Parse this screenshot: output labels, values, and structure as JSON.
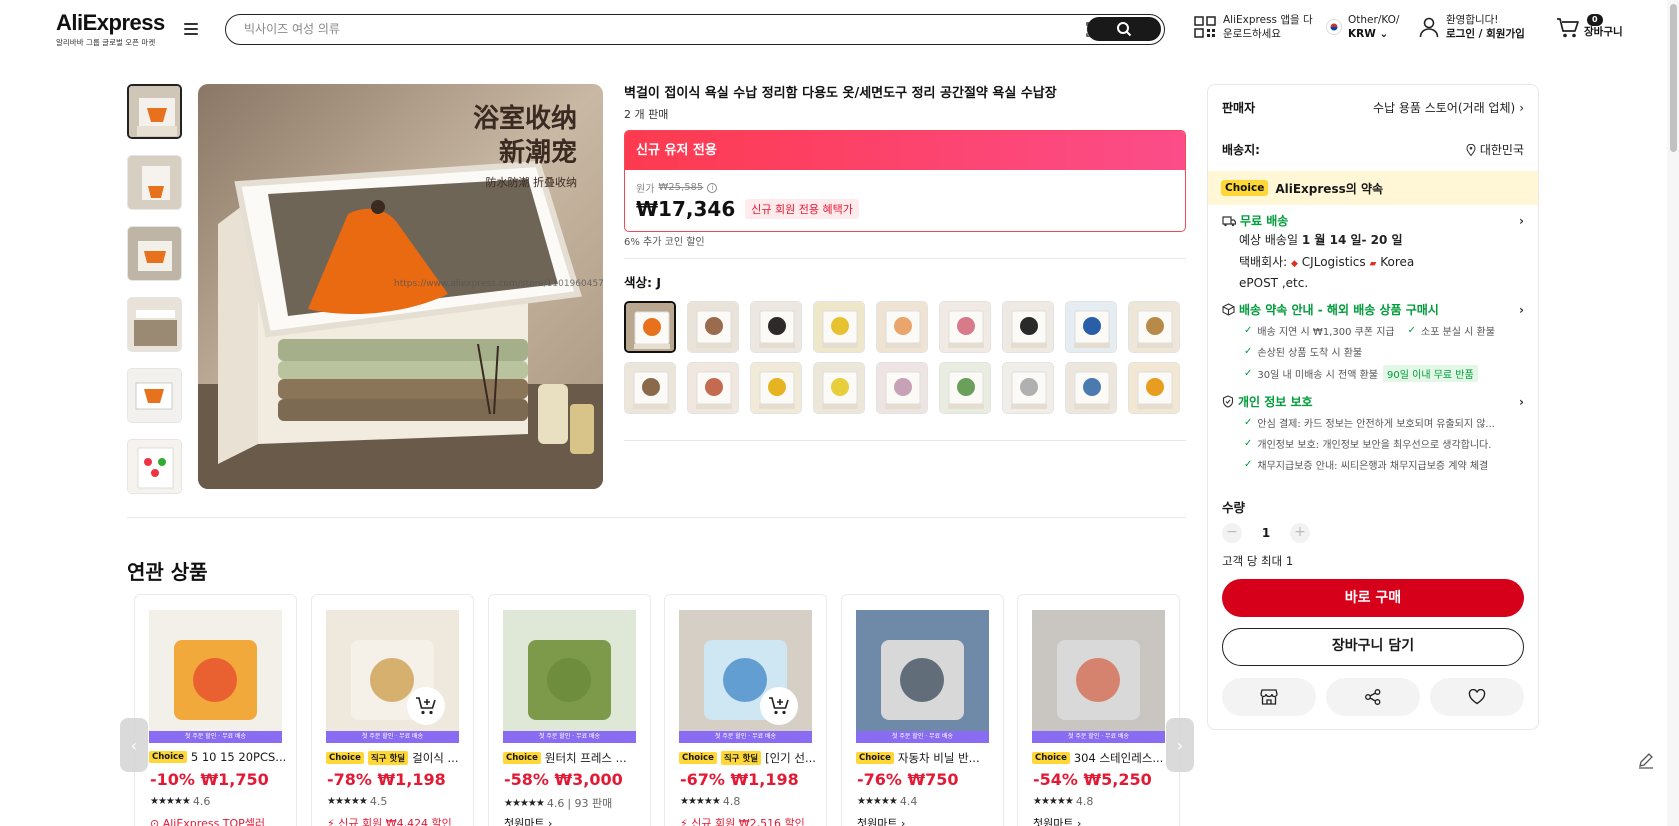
{
  "header": {
    "logo": "AliExpress",
    "logo_sub": "알리바바 그룹 글로벌 오픈 마켓",
    "search_placeholder": "빅사이즈 여성 의류",
    "app_line1": "AliExpress 앱을 다",
    "app_line2": "운로드하세요",
    "lang_line1": "Other/KO/",
    "lang_line2": "KRW",
    "account_line1": "환영합니다!",
    "account_line2": "로그인 / 회원가입",
    "cart_count": "0",
    "cart_label": "장바구니"
  },
  "gallery": {
    "cn_line1": "浴室收纳",
    "cn_line2": "新潮宠",
    "cn_line3": "防水防潮 折叠收纳",
    "watermark": "https://www.aliexpress.com/store/1101960457"
  },
  "product": {
    "title": "벽걸이 접이식 욕실 수납 정리함 다용도 옷/세면도구 정리 공간절약 욕실 수납장",
    "sold": "2 개 판매",
    "promo_head": "신규 유저 전용",
    "orig_label": "원가",
    "orig_price": "₩25,585",
    "price": "₩17,346",
    "new_tag": "신규 회원 전용 혜택가",
    "coin": "6% 추가 코인 할인",
    "color_label": "색상: J"
  },
  "panel": {
    "seller_key": "판매자",
    "seller_val": "수납 용품 스토어(거래 업체)",
    "ship_key": "배송지:",
    "ship_val": "대한민국",
    "choice_badge": "Choice",
    "choice_text": "AliExpress의 약속",
    "free_ship": "무료 배송",
    "eta_prefix": "예상 배송일",
    "eta": "1 월 14 일- 20 일",
    "carrier_line1": "택배회사:",
    "carrier_a": "CJLogistics",
    "carrier_b": "Korea",
    "carrier_line2": "ePOST ,etc.",
    "guide_head": "배송 약속 안내 - 해외 배송 상품 구매시",
    "guide1": "배송 지연 시 ₩1,300 쿠폰 지급",
    "guide1b": "소포 분실 시 환불",
    "guide2": "손상된 상품 도착 시 환불",
    "guide3": "30일 내 미배송 시 전액 환불",
    "guide3_tag": "90일 이내 무료 반품",
    "privacy_head": "개인 정보 보호",
    "privacy1": "안심 결제: 카드 정보는 안전하게 보호되며 유출되지 않...",
    "privacy2": "개인정보 보호: 개인정보 보안을 최우선으로 생각합니다.",
    "privacy3": "채무지급보증 안내: 씨티은행과 채무지급보증 계약 체결",
    "qty_label": "수량",
    "qty_minus": "−",
    "qty_value": "1",
    "qty_plus": "+",
    "limit": "고객 당 최대 1",
    "buy": "바로 구매",
    "add_cart": "장바구니 담기"
  },
  "related": {
    "title": "연관 상품",
    "ribbon": "첫 주문 할인 · 무료 배송",
    "cards": [
      {
        "badge": "Choice",
        "deal": "",
        "name": "5 10 15 20PCS...",
        "price": "-10% ₩1,750",
        "rating": "4.6",
        "sold": "",
        "extra": "AliExpress TOP셀러"
      },
      {
        "badge": "Choice",
        "deal": "직구 핫딜",
        "name": "걸이식 ...",
        "price": "-78% ₩1,198",
        "rating": "4.5",
        "sold": "",
        "extra": "신규 회원 ₩4,424 할인"
      },
      {
        "badge": "Choice",
        "deal": "",
        "name": "원터치 프레스 ...",
        "price": "-58% ₩3,000",
        "rating": "4.6",
        "sold": "| 93 판매",
        "extra": "첫원마트 ›"
      },
      {
        "badge": "Choice",
        "deal": "직구 핫딜",
        "name": "[인기 선...",
        "price": "-67% ₩1,198",
        "rating": "4.8",
        "sold": "",
        "extra": "신규 회원 ₩2,516 할인"
      },
      {
        "badge": "Choice",
        "deal": "",
        "name": "자동차 비닐 반...",
        "price": "-76% ₩750",
        "rating": "4.4",
        "sold": "",
        "extra": "첫원마트 ›"
      },
      {
        "badge": "Choice",
        "deal": "",
        "name": "304 스테인레스...",
        "price": "-54% ₩5,250",
        "rating": "4.8",
        "sold": "",
        "extra": "첫원마트 ›"
      }
    ],
    "stars": "★★★★★",
    "prev": "‹",
    "next": "›"
  }
}
